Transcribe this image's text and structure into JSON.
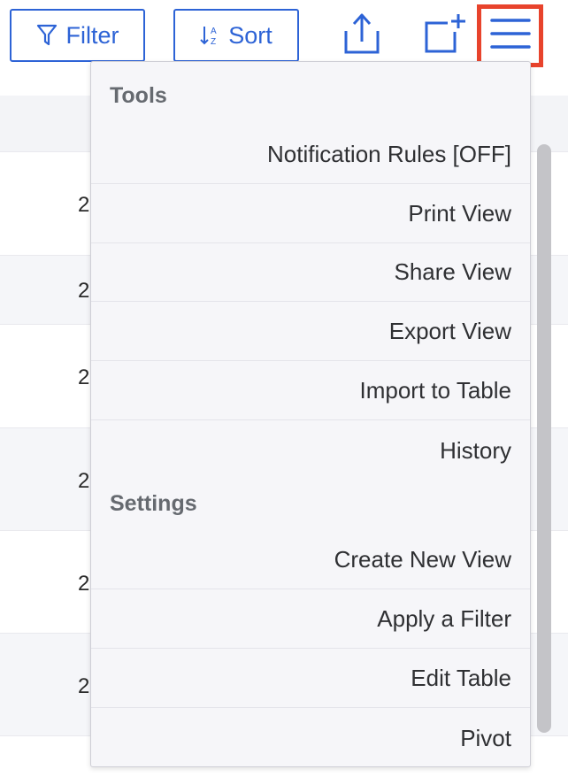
{
  "toolbar": {
    "filter_label": "Filter",
    "sort_label": "Sort",
    "filter_icon": "funnel-icon",
    "sort_icon": "sort-az-icon",
    "share_icon": "upload-share-icon",
    "add_icon": "add-view-icon",
    "menu_icon": "hamburger-menu-icon",
    "accent_color": "#2d63d6",
    "highlight_color": "#e8432c"
  },
  "table": {
    "cells": [
      "2",
      "2",
      "2",
      "2",
      "2",
      "2"
    ]
  },
  "menu": {
    "tools_header": "Tools",
    "settings_header": "Settings",
    "tools": [
      "Notification Rules [OFF]",
      "Print View",
      "Share View",
      "Export View",
      "Import to Table",
      "History"
    ],
    "settings": [
      "Create New View",
      "Apply a Filter",
      "Edit Table",
      "Pivot"
    ]
  }
}
